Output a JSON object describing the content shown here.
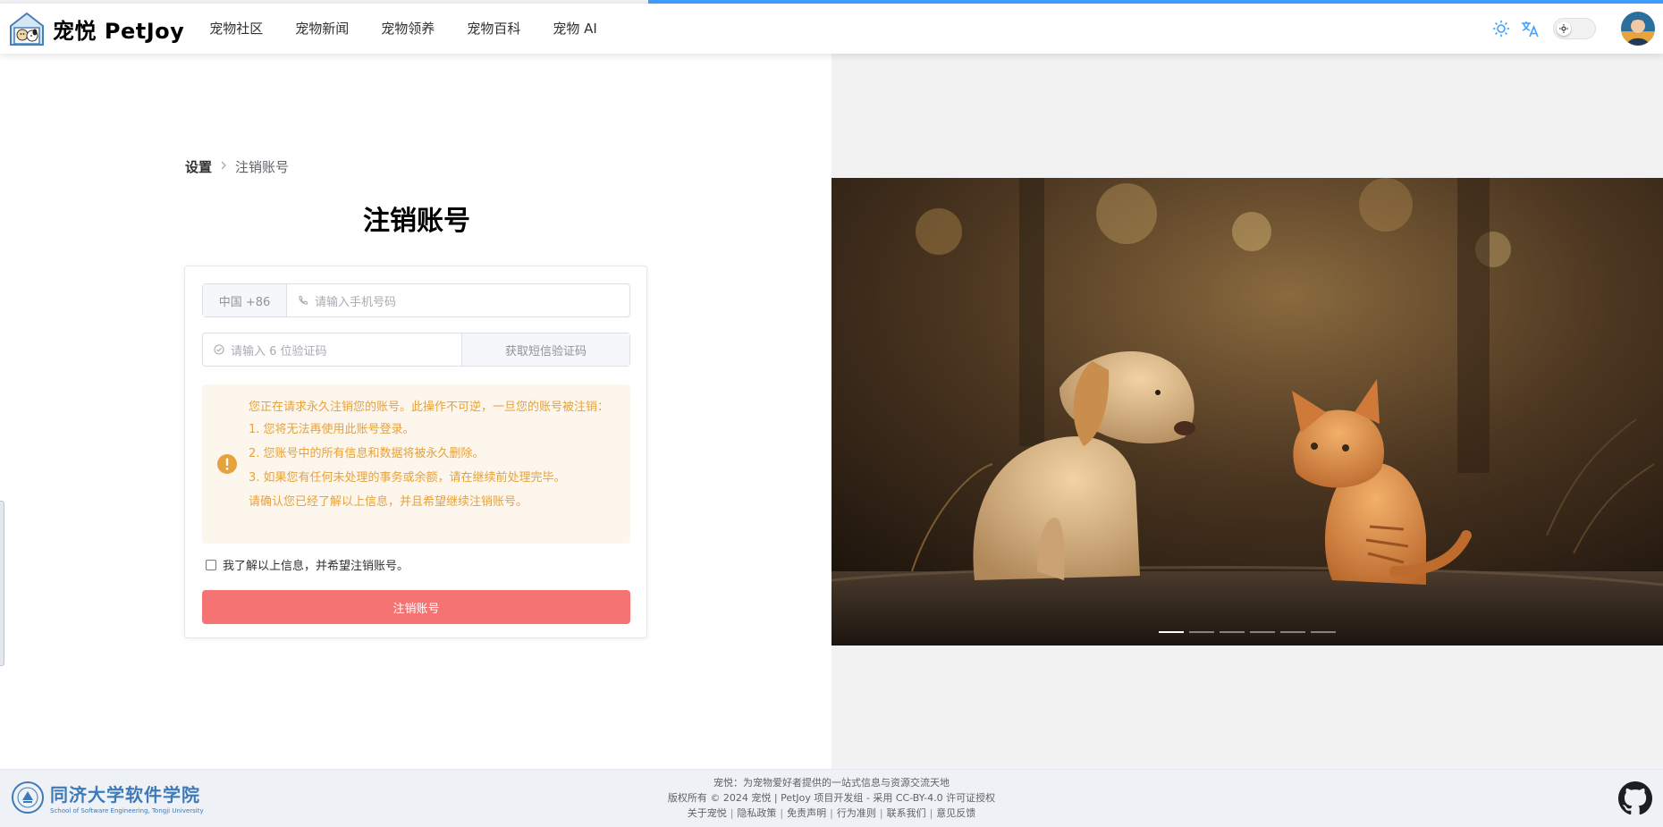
{
  "app": {
    "logo_text": "宠悦 PetJoy",
    "progress_percent": 61
  },
  "nav": {
    "items": [
      {
        "label": "宠物社区"
      },
      {
        "label": "宠物新闻"
      },
      {
        "label": "宠物领养"
      },
      {
        "label": "宠物百科"
      },
      {
        "label": "宠物 AI"
      }
    ]
  },
  "header_icons": [
    "sun-icon",
    "translate-icon",
    "theme-switch",
    "avatar"
  ],
  "breadcrumb": {
    "parent": "设置",
    "current": "注销账号"
  },
  "page": {
    "title": "注销账号"
  },
  "form": {
    "country_prefix": "中国 +86",
    "phone_placeholder": "请输入手机号码",
    "code_placeholder": "请输入 6 位验证码",
    "send_code_label": "获取短信验证码",
    "warning_lines": [
      "您正在请求永久注销您的账号。此操作不可逆，一旦您的账号被注销：",
      "1. 您将无法再使用此账号登录。",
      "2. 您账号中的所有信息和数据将被永久删除。",
      "3. 如果您有任何未处理的事务或余额，请在继续前处理完毕。",
      "请确认您已经了解以上信息，并且希望继续注销账号。"
    ],
    "agree_label": "我了解以上信息，并希望注销账号。",
    "agree_checked": false,
    "submit_label": "注销账号"
  },
  "carousel": {
    "slide_count": 6,
    "active_index": 0
  },
  "footer": {
    "school_name": "同济大学软件学院",
    "school_sub": "School of Software Engineering, Tongji University",
    "tagline": "宠悦：为宠物爱好者提供的一站式信息与资源交流天地",
    "copyright": "版权所有 © 2024 宠悦 | PetJoy 项目开发组 - 采用 CC-BY-4.0 许可证授权",
    "links": [
      "关于宠悦",
      "隐私政策",
      "免责声明",
      "行为准则",
      "联系我们",
      "意见反馈"
    ]
  },
  "colors": {
    "accent": "#409eff",
    "danger": "#f56c6c",
    "warning_text": "#e6a23c",
    "warning_bg": "#fdf6ec",
    "school_blue": "#3f7ab8"
  }
}
